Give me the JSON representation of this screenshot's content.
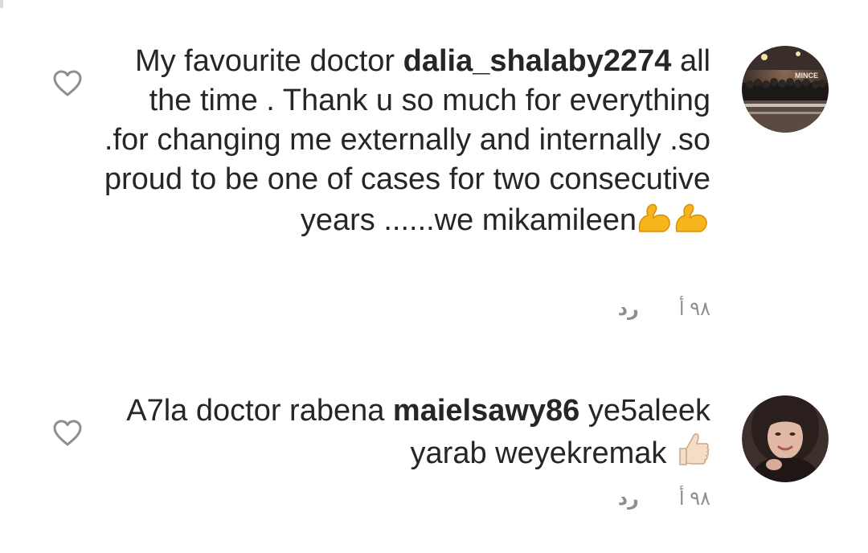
{
  "comments": [
    {
      "username": "dalia_shalaby2274",
      "text_before": "My favourite doctor ",
      "text_after": " all the time . Thank u so much for everything .for changing me externally and internally .so proud to  be one of cases for two consecutive years ......we mikamileen",
      "emoji": "💪💪",
      "emoji_icon": "flexed-biceps-icon",
      "avatar_icon": "group-photo-avatar",
      "avatar_text": "MINCE",
      "time": "٩٨ أ",
      "reply_label": "رد",
      "like_icon": "heart-outline-icon"
    },
    {
      "username": "maielsawy86",
      "text_before": "A7la doctor rabena ",
      "text_after": " ye5aleek yarab weyekremak ",
      "emoji": "👍🏻",
      "emoji_icon": "thumbs-up-icon",
      "avatar_icon": "woman-portrait-avatar",
      "time": "٩٨ أ",
      "reply_label": "رد",
      "like_icon": "heart-outline-icon"
    }
  ],
  "colors": {
    "text": "#262626",
    "meta": "#8e8e8e",
    "background": "#ffffff"
  }
}
